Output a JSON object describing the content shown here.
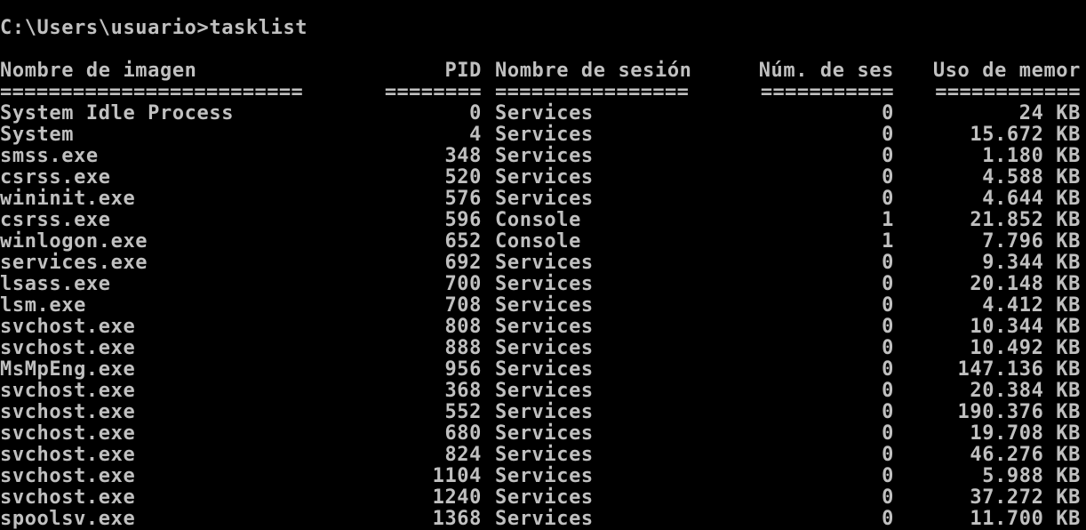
{
  "window": {
    "prompt": "C:\\Users\\usuario>tasklist"
  },
  "table": {
    "headers": {
      "name": "Nombre de imagen",
      "pid": "PID",
      "session": "Nombre de sesión",
      "session_num": "Núm. de ses",
      "memory": "Uso de memor"
    },
    "separators": {
      "name": "=========================",
      "pid": "========",
      "session": "================",
      "session_num": "===========",
      "memory": "============"
    },
    "rows": [
      {
        "name": "System Idle Process",
        "pid": "0",
        "session": "Services",
        "session_num": "0",
        "memory": "24 KB"
      },
      {
        "name": "System",
        "pid": "4",
        "session": "Services",
        "session_num": "0",
        "memory": "15.672 KB"
      },
      {
        "name": "smss.exe",
        "pid": "348",
        "session": "Services",
        "session_num": "0",
        "memory": "1.180 KB"
      },
      {
        "name": "csrss.exe",
        "pid": "520",
        "session": "Services",
        "session_num": "0",
        "memory": "4.588 KB"
      },
      {
        "name": "wininit.exe",
        "pid": "576",
        "session": "Services",
        "session_num": "0",
        "memory": "4.644 KB"
      },
      {
        "name": "csrss.exe",
        "pid": "596",
        "session": "Console",
        "session_num": "1",
        "memory": "21.852 KB"
      },
      {
        "name": "winlogon.exe",
        "pid": "652",
        "session": "Console",
        "session_num": "1",
        "memory": "7.796 KB"
      },
      {
        "name": "services.exe",
        "pid": "692",
        "session": "Services",
        "session_num": "0",
        "memory": "9.344 KB"
      },
      {
        "name": "lsass.exe",
        "pid": "700",
        "session": "Services",
        "session_num": "0",
        "memory": "20.148 KB"
      },
      {
        "name": "lsm.exe",
        "pid": "708",
        "session": "Services",
        "session_num": "0",
        "memory": "4.412 KB"
      },
      {
        "name": "svchost.exe",
        "pid": "808",
        "session": "Services",
        "session_num": "0",
        "memory": "10.344 KB"
      },
      {
        "name": "svchost.exe",
        "pid": "888",
        "session": "Services",
        "session_num": "0",
        "memory": "10.492 KB"
      },
      {
        "name": "MsMpEng.exe",
        "pid": "956",
        "session": "Services",
        "session_num": "0",
        "memory": "147.136 KB"
      },
      {
        "name": "svchost.exe",
        "pid": "368",
        "session": "Services",
        "session_num": "0",
        "memory": "20.384 KB"
      },
      {
        "name": "svchost.exe",
        "pid": "552",
        "session": "Services",
        "session_num": "0",
        "memory": "190.376 KB"
      },
      {
        "name": "svchost.exe",
        "pid": "680",
        "session": "Services",
        "session_num": "0",
        "memory": "19.708 KB"
      },
      {
        "name": "svchost.exe",
        "pid": "824",
        "session": "Services",
        "session_num": "0",
        "memory": "46.276 KB"
      },
      {
        "name": "svchost.exe",
        "pid": "1104",
        "session": "Services",
        "session_num": "0",
        "memory": "5.988 KB"
      },
      {
        "name": "svchost.exe",
        "pid": "1240",
        "session": "Services",
        "session_num": "0",
        "memory": "37.272 KB"
      },
      {
        "name": "spoolsv.exe",
        "pid": "1368",
        "session": "Services",
        "session_num": "0",
        "memory": "11.700 KB"
      }
    ]
  },
  "colors": {
    "background": "#000000",
    "text": "#c0c0c0"
  }
}
